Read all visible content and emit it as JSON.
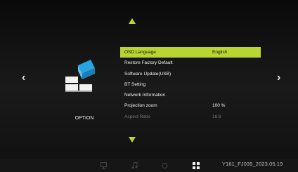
{
  "menu": {
    "items": [
      {
        "label": "OSD Language",
        "value": "English",
        "state": "selected"
      },
      {
        "label": "Restore Factory Default",
        "value": "",
        "state": "normal"
      },
      {
        "label": "Software Update(USB)",
        "value": "",
        "state": "normal"
      },
      {
        "label": "BT Setting",
        "value": "",
        "state": "normal"
      },
      {
        "label": "Network Information",
        "value": "",
        "state": "normal"
      },
      {
        "label": "Projection zoom",
        "value": "100 %",
        "state": "normal"
      },
      {
        "label": "Aspect Ratio",
        "value": "16:9",
        "state": "disabled"
      }
    ]
  },
  "category": {
    "label": "OPTION",
    "icon": "option-blocks-icon"
  },
  "nav": {
    "left_glyph": "‹",
    "right_glyph": "›"
  },
  "bottom_bar": {
    "icons": [
      "monitor-icon",
      "music-note-icon",
      "circle-icon",
      "grid-icon"
    ],
    "version": "Y161_FJ035_2023.05.19"
  },
  "colors": {
    "accent": "#b9d531",
    "background": "#000000",
    "disabled_text": "#777777"
  }
}
